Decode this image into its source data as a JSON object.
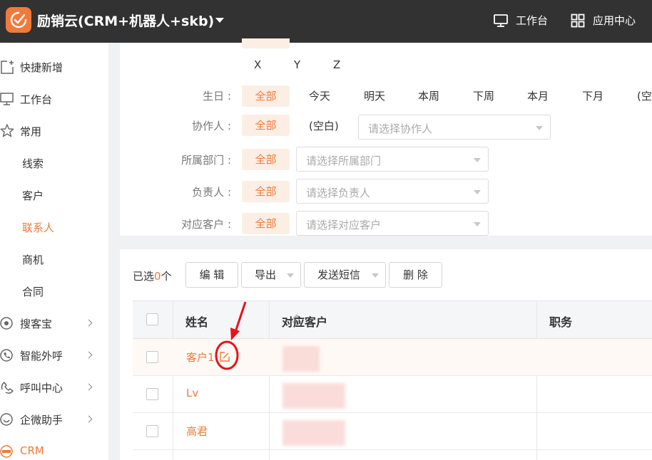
{
  "app": {
    "title": "励销云(CRM+机器人+skb)"
  },
  "header": {
    "workbench_label": "工作台",
    "apps_label": "应用中心"
  },
  "sidebar": {
    "items": [
      {
        "label": "快捷新增"
      },
      {
        "label": "工作台"
      },
      {
        "label": "常用"
      },
      {
        "label": "线索"
      },
      {
        "label": "客户"
      },
      {
        "label": "联系人",
        "active": true
      },
      {
        "label": "商机"
      },
      {
        "label": "合同"
      },
      {
        "label": "搜客宝"
      },
      {
        "label": "智能外呼"
      },
      {
        "label": "呼叫中心"
      },
      {
        "label": "企微助手"
      },
      {
        "label": "CRM"
      }
    ]
  },
  "filters": {
    "letters": [
      "X",
      "Y",
      "Z"
    ],
    "birthday": {
      "label": "生日 :",
      "all": "全部",
      "options": [
        "今天",
        "明天",
        "本周",
        "下周",
        "本月",
        "下月",
        "(空"
      ]
    },
    "collaborator": {
      "label": "协作人 :",
      "all": "全部",
      "empty": "(空白)",
      "placeholder": "请选择协作人"
    },
    "department": {
      "label": "所属部门 :",
      "all": "全部",
      "placeholder": "请选择所属部门"
    },
    "owner": {
      "label": "负责人 :",
      "all": "全部",
      "placeholder": "请选择负责人"
    },
    "customer": {
      "label": "对应客户 :",
      "all": "全部",
      "placeholder": "请选择对应客户"
    }
  },
  "toolbar": {
    "selected_prefix": "已选",
    "selected_count": "0",
    "selected_suffix": "个",
    "edit": "编 辑",
    "export": "导出",
    "sms": "发送短信",
    "delete": "删 除"
  },
  "table": {
    "columns": [
      "姓名",
      "对应客户",
      "职务"
    ],
    "rows": [
      {
        "name": "客户1"
      },
      {
        "name": "Lv"
      },
      {
        "name": "高君"
      }
    ]
  },
  "colors": {
    "accent": "#f07a3b",
    "topbar": "#323232",
    "annotation": "#e8121b"
  }
}
